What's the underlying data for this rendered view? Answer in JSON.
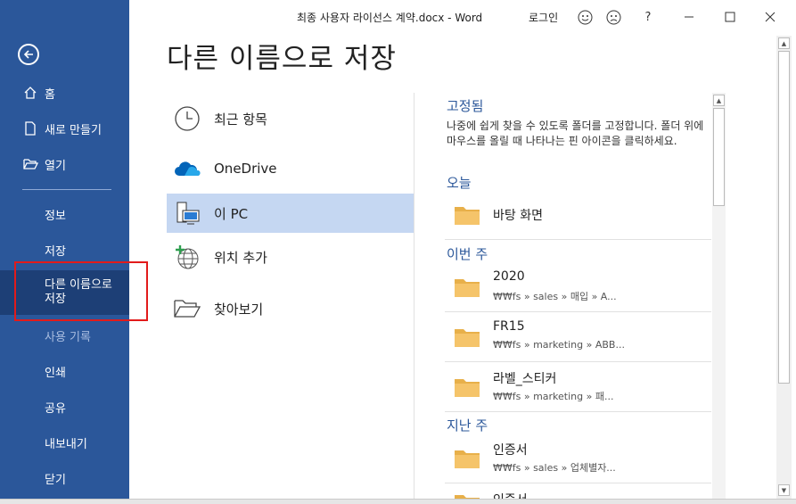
{
  "window": {
    "title": "최종 사용자 라이선스 계약.docx  -  Word",
    "signin": "로그인",
    "help": "?",
    "minimize_icon": "minimize-icon",
    "maximize_icon": "maximize-icon",
    "close_icon": "close-icon"
  },
  "sidebar": {
    "back_icon": "back-arrow-icon",
    "items": [
      {
        "label": "홈",
        "icon": "home-icon"
      },
      {
        "label": "새로 만들기",
        "icon": "new-document-icon"
      },
      {
        "label": "열기",
        "icon": "open-folder-icon"
      },
      {
        "label": "정보"
      },
      {
        "label": "저장"
      },
      {
        "label_line1": "다른 이름으로",
        "label_line2": "저장"
      },
      {
        "label": "사용 기록"
      },
      {
        "label": "인쇄"
      },
      {
        "label": "공유"
      },
      {
        "label": "내보내기"
      },
      {
        "label": "닫기"
      }
    ]
  },
  "page": {
    "title": "다른 이름으로 저장"
  },
  "locations": [
    {
      "label": "최근 항목",
      "icon": "clock-icon"
    },
    {
      "label": "OneDrive",
      "icon": "onedrive-cloud-icon"
    },
    {
      "label": "이 PC",
      "icon": "this-pc-icon"
    },
    {
      "label": "위치 추가",
      "icon": "add-place-globe-icon"
    },
    {
      "label": "찾아보기",
      "icon": "browse-folder-icon"
    }
  ],
  "right_panel": {
    "pinned_header": "고정됨",
    "pinned_desc": "나중에 쉽게 찾을 수 있도록 폴더를 고정합니다. 폴더 위에 마우스를 올릴 때 나타나는 핀 아이콘을 클릭하세요.",
    "today_header": "오늘",
    "this_week_header": "이번 주",
    "last_week_header": "지난 주",
    "today": [
      {
        "name": "바탕 화면"
      }
    ],
    "this_week": [
      {
        "name": "2020",
        "path": "₩₩fs » sales » 매입 » A..."
      },
      {
        "name": "FR15",
        "path": "₩₩fs » marketing » ABB..."
      },
      {
        "name": "라벨_스티커",
        "path": "₩₩fs » marketing » 패..."
      }
    ],
    "last_week": [
      {
        "name": "인증서",
        "path": "₩₩fs » sales » 업체별자..."
      },
      {
        "name": "인증서"
      }
    ]
  },
  "colors": {
    "sidebar_bg": "#2b579a",
    "sidebar_selected": "#1d3f76",
    "accent": "#2b579a",
    "highlight_box": "#e21b1b",
    "selected_location": "#c5d7f2",
    "folder": "#f5c46a"
  }
}
